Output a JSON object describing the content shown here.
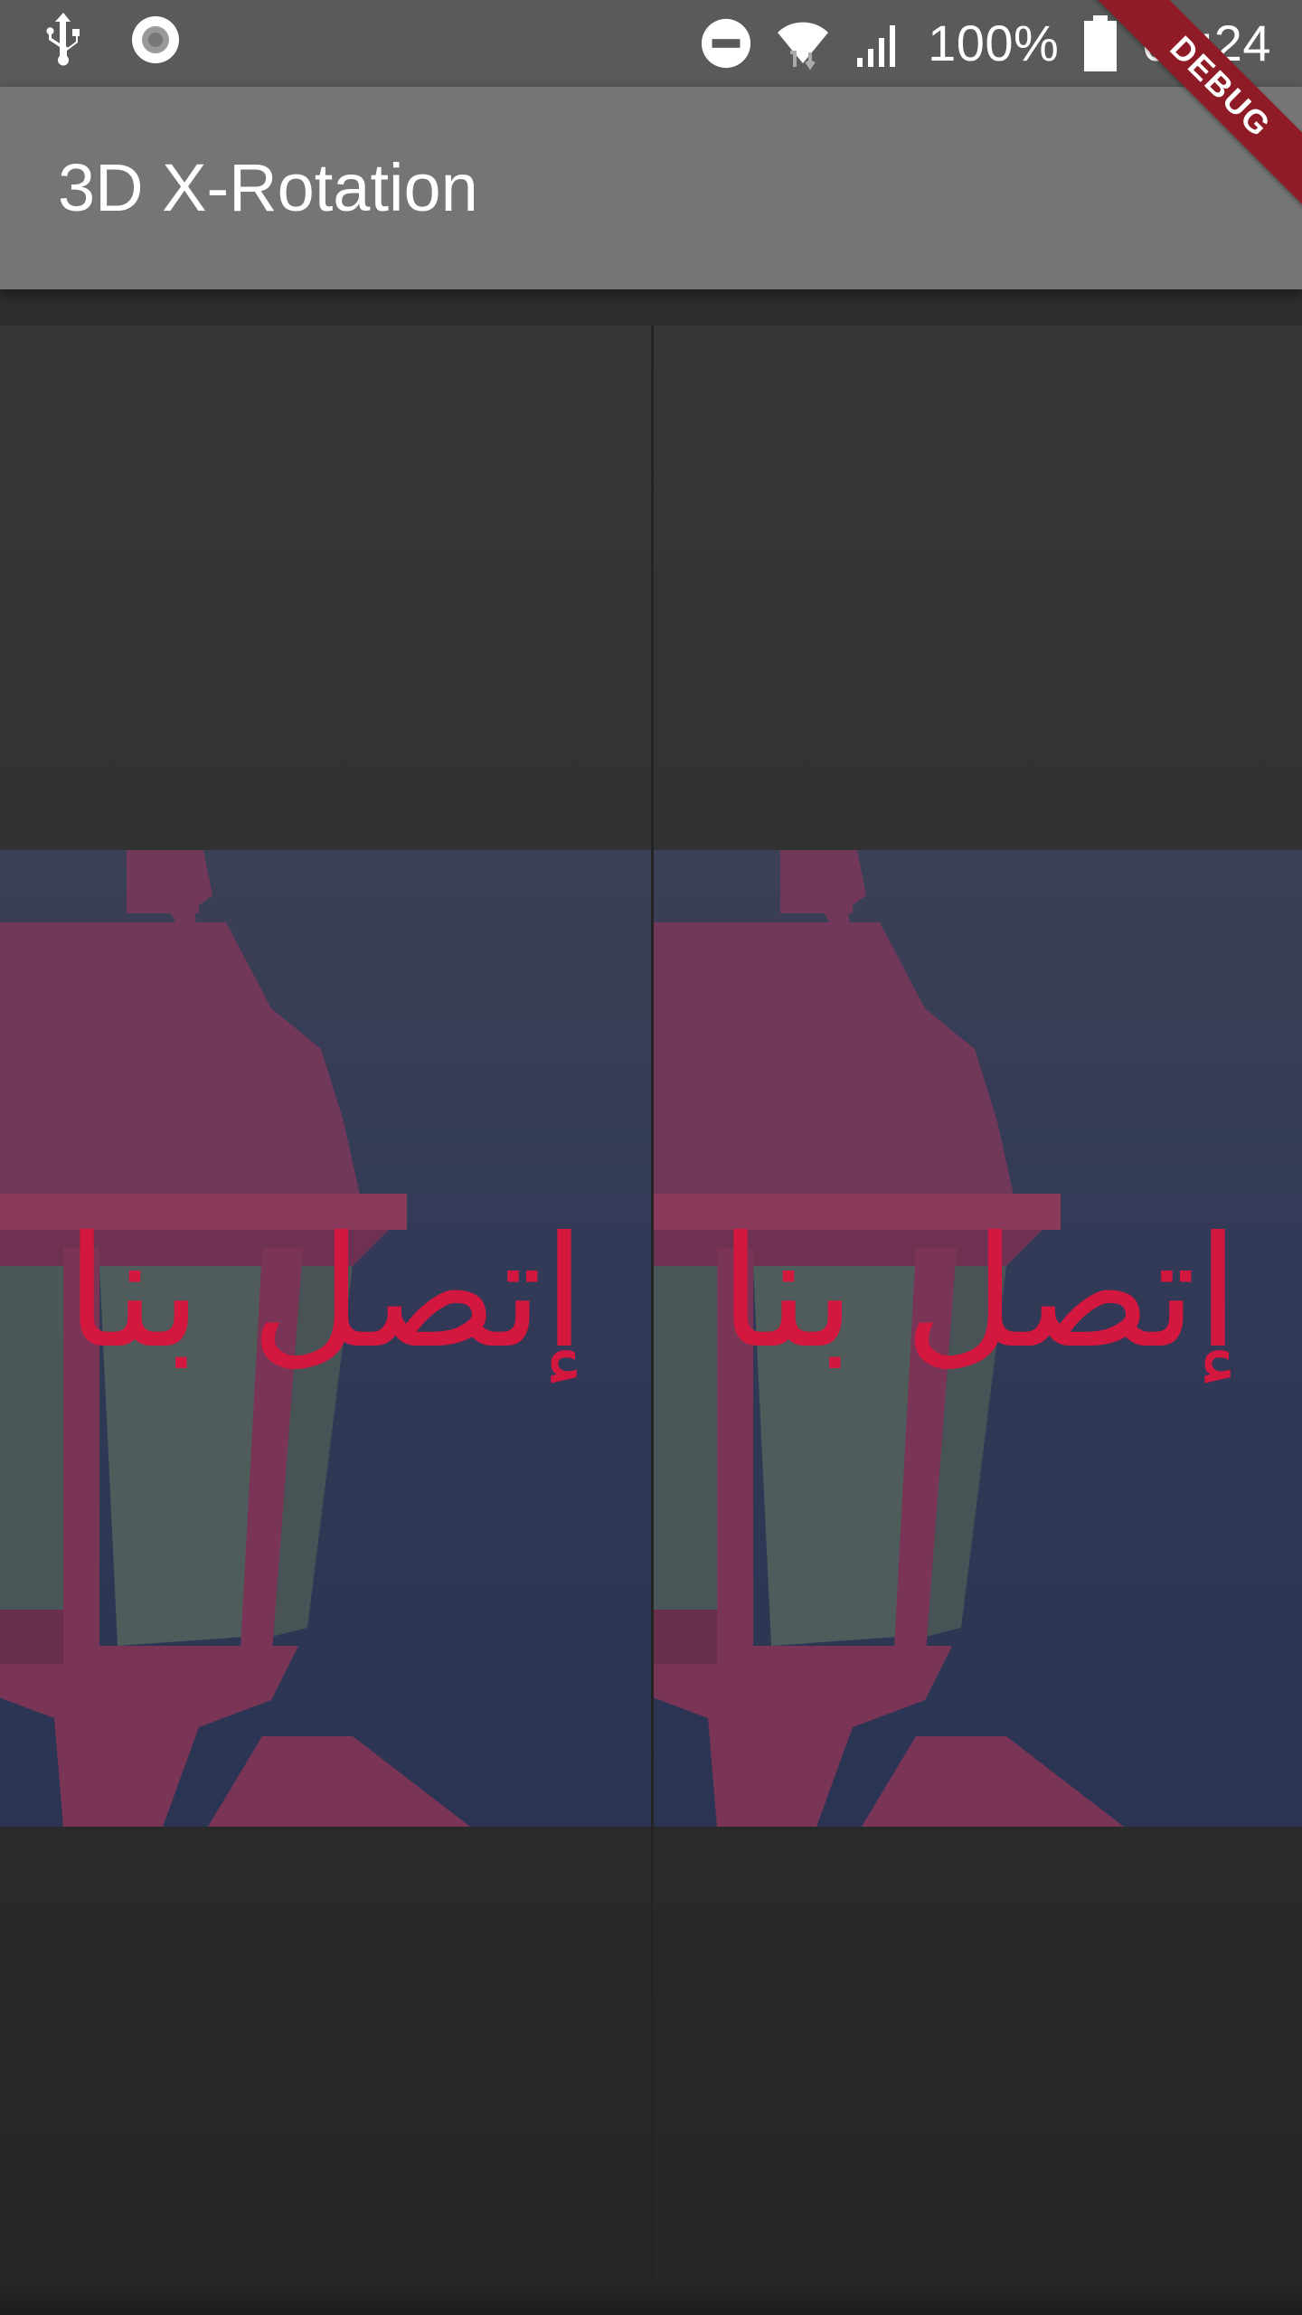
{
  "status_bar": {
    "battery_text": "100%",
    "time": "00:24",
    "icons": [
      "usb-icon",
      "record-icon",
      "do-not-disturb-icon",
      "wifi-icon",
      "signal-icon",
      "battery-icon"
    ]
  },
  "app_bar": {
    "title": "3D X-Rotation",
    "debug_label": "DEBUG"
  },
  "panels": [
    {
      "caption": "إتصل بنا"
    },
    {
      "caption": "إتصل بنا"
    }
  ],
  "colors": {
    "status_bar": "#5a5a5a",
    "app_bar": "#757575",
    "caption": "#d3173f",
    "photo_sky": "#333a57",
    "lamp": "#8a3a5a"
  }
}
